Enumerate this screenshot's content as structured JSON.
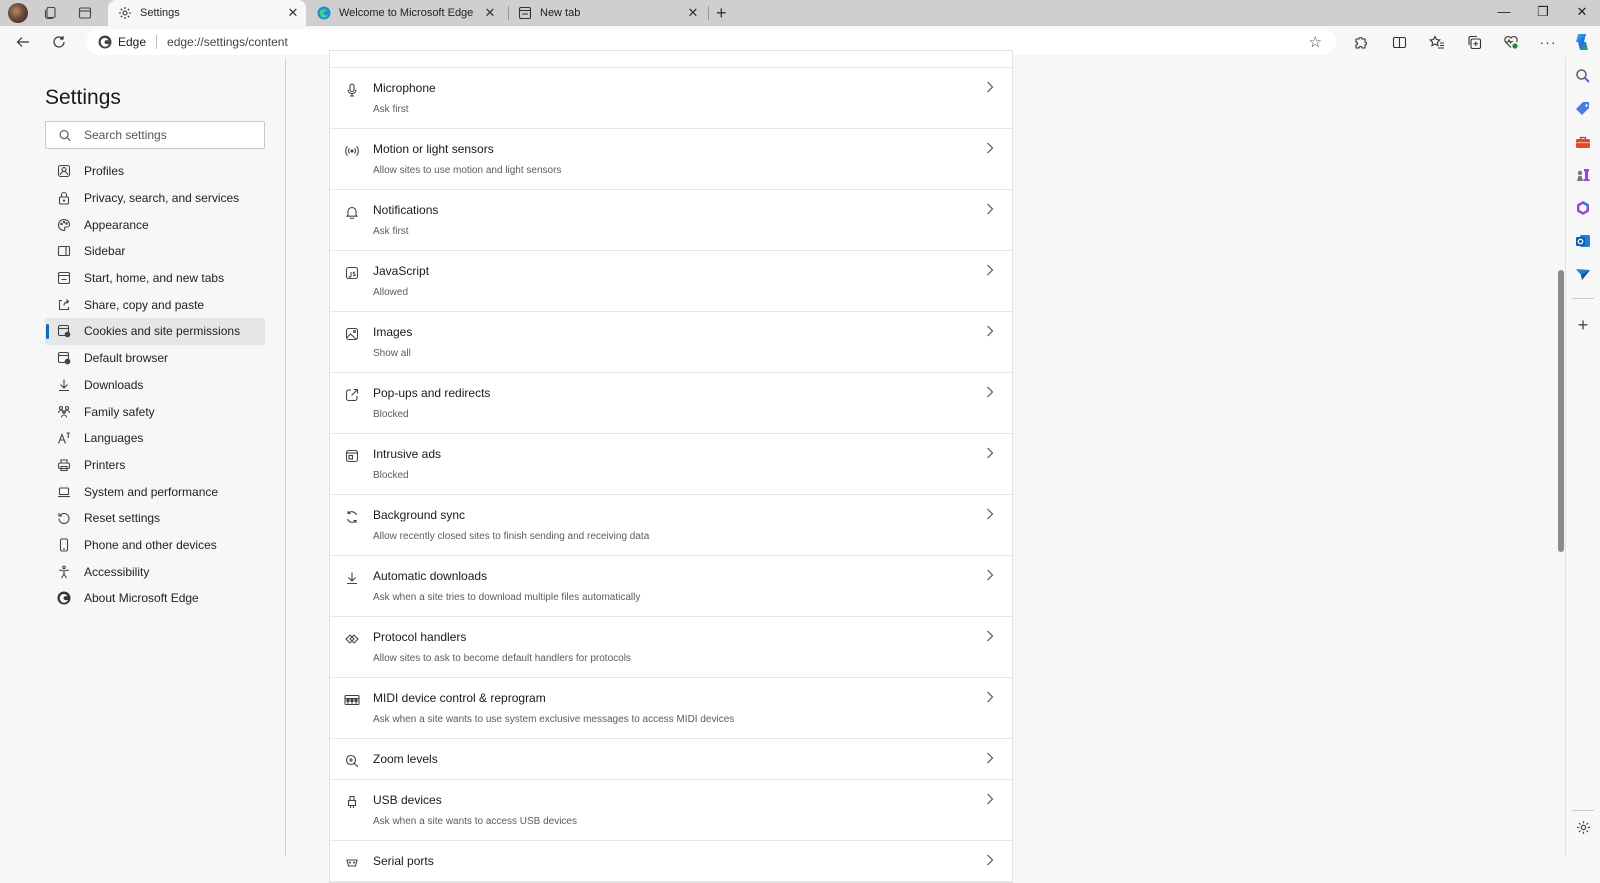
{
  "browser": {
    "tabs": [
      {
        "title": "Settings",
        "icon": "gear-icon",
        "active": true
      },
      {
        "title": "Welcome to Microsoft Edge",
        "icon": "edge-logo-icon",
        "active": false
      },
      {
        "title": "New tab",
        "icon": "new-tab-page-icon",
        "active": false
      }
    ],
    "close_glyph": "✕",
    "new_tab_glyph": "+",
    "window_controls": {
      "minimize": "—",
      "restore": "❐",
      "close": "✕"
    },
    "address": {
      "site_label": "Edge",
      "url": "edge://settings/content"
    }
  },
  "leftnav": {
    "title": "Settings",
    "search_placeholder": "Search settings",
    "items": [
      {
        "label": "Profiles",
        "icon": "profile-icon"
      },
      {
        "label": "Privacy, search, and services",
        "icon": "lock-icon"
      },
      {
        "label": "Appearance",
        "icon": "palette-icon"
      },
      {
        "label": "Sidebar",
        "icon": "sidebar-icon"
      },
      {
        "label": "Start, home, and new tabs",
        "icon": "home-tabs-icon"
      },
      {
        "label": "Share, copy and paste",
        "icon": "share-icon"
      },
      {
        "label": "Cookies and site permissions",
        "icon": "cookies-icon",
        "selected": true
      },
      {
        "label": "Default browser",
        "icon": "default-browser-icon"
      },
      {
        "label": "Downloads",
        "icon": "download-icon"
      },
      {
        "label": "Family safety",
        "icon": "family-icon"
      },
      {
        "label": "Languages",
        "icon": "languages-icon"
      },
      {
        "label": "Printers",
        "icon": "printer-icon"
      },
      {
        "label": "System and performance",
        "icon": "laptop-icon"
      },
      {
        "label": "Reset settings",
        "icon": "reset-icon"
      },
      {
        "label": "Phone and other devices",
        "icon": "phone-icon"
      },
      {
        "label": "Accessibility",
        "icon": "accessibility-icon"
      },
      {
        "label": "About Microsoft Edge",
        "icon": "edge-logo-icon"
      }
    ]
  },
  "permissions": [
    {
      "title": "Microphone",
      "subtitle": "Ask first",
      "icon": "microphone-icon"
    },
    {
      "title": "Motion or light sensors",
      "subtitle": "Allow sites to use motion and light sensors",
      "icon": "sensors-icon"
    },
    {
      "title": "Notifications",
      "subtitle": "Ask first",
      "icon": "bell-icon"
    },
    {
      "title": "JavaScript",
      "subtitle": "Allowed",
      "icon": "javascript-icon"
    },
    {
      "title": "Images",
      "subtitle": "Show all",
      "icon": "image-icon"
    },
    {
      "title": "Pop-ups and redirects",
      "subtitle": "Blocked",
      "icon": "popup-icon"
    },
    {
      "title": "Intrusive ads",
      "subtitle": "Blocked",
      "icon": "ads-icon"
    },
    {
      "title": "Background sync",
      "subtitle": "Allow recently closed sites to finish sending and receiving data",
      "icon": "sync-icon"
    },
    {
      "title": "Automatic downloads",
      "subtitle": "Ask when a site tries to download multiple files automatically",
      "icon": "download-icon"
    },
    {
      "title": "Protocol handlers",
      "subtitle": "Allow sites to ask to become default handlers for protocols",
      "icon": "protocol-icon"
    },
    {
      "title": "MIDI device control & reprogram",
      "subtitle": "Ask when a site wants to use system exclusive messages to access MIDI devices",
      "icon": "midi-icon"
    },
    {
      "title": "Zoom levels",
      "subtitle": "",
      "icon": "zoom-icon"
    },
    {
      "title": "USB devices",
      "subtitle": "Ask when a site wants to access USB devices",
      "icon": "usb-icon"
    },
    {
      "title": "Serial ports",
      "subtitle": "",
      "icon": "serial-port-icon"
    }
  ],
  "colors": {
    "accent": "#0f6cbd",
    "tabstrip": "#cfcfcf",
    "page_bg": "#f7f7f7",
    "selected_nav_bg": "#e6e6e6"
  }
}
